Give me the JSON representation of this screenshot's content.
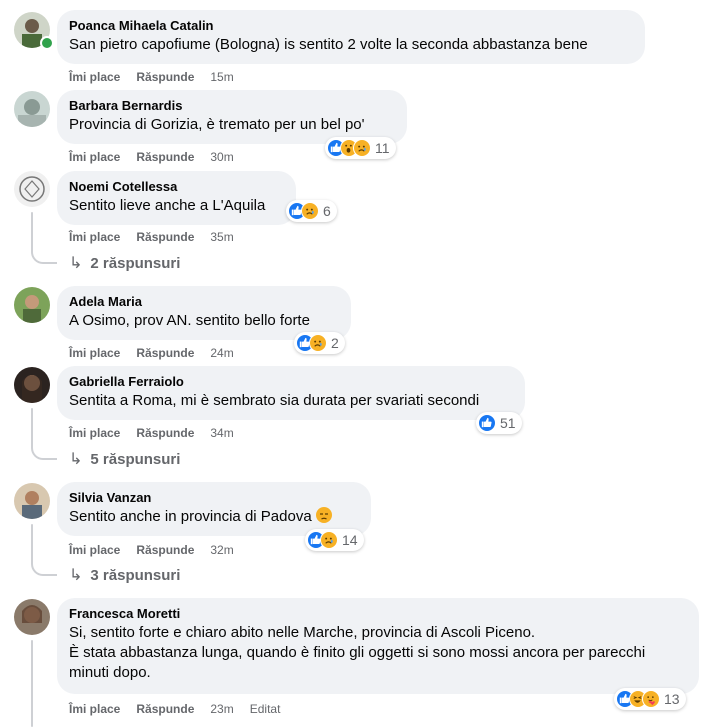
{
  "labels": {
    "like": "Îmi place",
    "reply": "Răspunde",
    "edited": "Editat"
  },
  "comments": [
    {
      "author": "Poanca Mihaela Catalin",
      "text": "San pietro capofiume (Bologna) is sentito 2 volte la seconda abbastanza bene",
      "time": "15m",
      "reaction_count": "",
      "reactions": [],
      "online": true
    },
    {
      "author": "Barbara Bernardis",
      "text": "Provincia di Gorizia, è tremato per un bel po'",
      "time": "30m",
      "reaction_count": "11",
      "reactions": [
        "like-icon",
        "wow-icon",
        "sad-icon"
      ]
    },
    {
      "author": "Noemi Cotellessa",
      "text": "Sentito lieve anche a L'Aquila",
      "time": "35m",
      "reaction_count": "6",
      "reactions": [
        "like-icon",
        "sad-icon"
      ],
      "replies": "2 răspunsuri"
    },
    {
      "author": "Adela Maria",
      "text": "A Osimo, prov AN. sentito bello forte",
      "time": "24m",
      "reaction_count": "2",
      "reactions": [
        "like-icon",
        "sad-icon"
      ]
    },
    {
      "author": "Gabriella Ferraiolo",
      "text": "Sentita a Roma, mi è sembrato sia durata per svariati secondi",
      "time": "34m",
      "reaction_count": "51",
      "reactions": [
        "like-icon"
      ],
      "replies": "5 răspunsuri"
    },
    {
      "author": "Silvia Vanzan",
      "text": "Sentito anche in provincia di Padova",
      "time": "32m",
      "reaction_count": "14",
      "reactions": [
        "like-icon",
        "sad-icon"
      ],
      "replies": "3 răspunsuri"
    },
    {
      "author": "Francesca Moretti",
      "text": "Si, sentito forte e chiaro abito nelle Marche, provincia di Ascoli Piceno.\nÈ stata abbastanza lunga, quando è finito gli oggetti si sono mossi ancora per parecchi minuti dopo.",
      "time": "23m",
      "reaction_count": "13",
      "reactions": [
        "like-icon",
        "haha-icon",
        "care-icon"
      ],
      "edited": true
    }
  ],
  "colors": {
    "bubble": "#f0f2f5",
    "like": "#1877f2",
    "emoji": "#f7b125",
    "meta": "#65676b",
    "online": "#31a24c"
  }
}
